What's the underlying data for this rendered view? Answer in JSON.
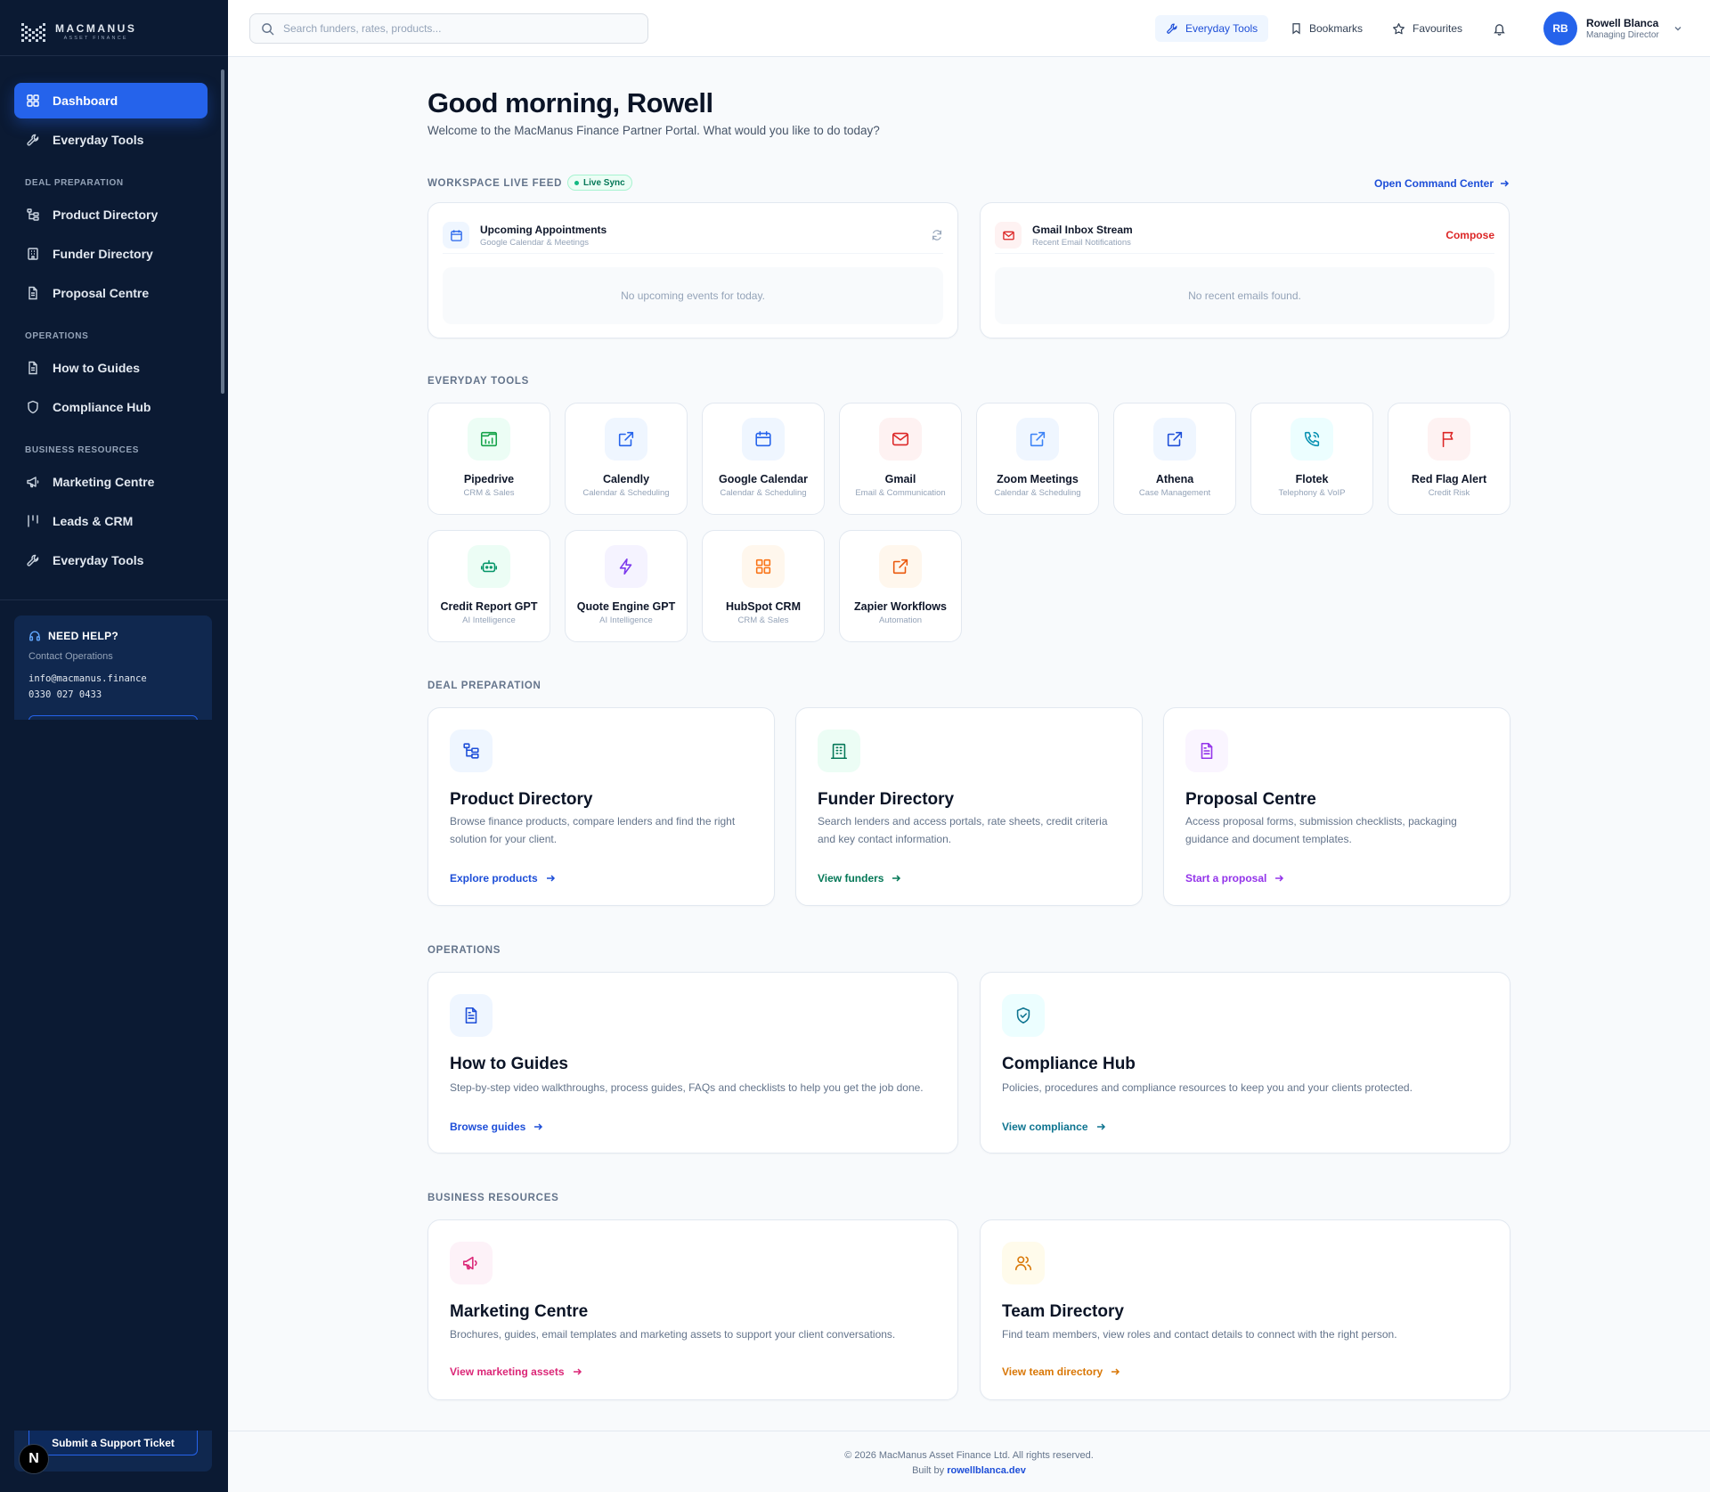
{
  "brand": {
    "name": "MACMANUS",
    "sub": "ASSET FINANCE"
  },
  "sidebar": {
    "items_top": [
      {
        "label": "Dashboard",
        "icon": "grid-icon",
        "active": true
      },
      {
        "label": "Everyday Tools",
        "icon": "wrench-icon"
      }
    ],
    "sections": [
      {
        "title": "DEAL PREPARATION",
        "items": [
          {
            "label": "Product Directory",
            "icon": "tree-icon"
          },
          {
            "label": "Funder Directory",
            "icon": "building-icon"
          },
          {
            "label": "Proposal Centre",
            "icon": "document-icon"
          }
        ]
      },
      {
        "title": "OPERATIONS",
        "items": [
          {
            "label": "How to Guides",
            "icon": "document-icon"
          },
          {
            "label": "Compliance Hub",
            "icon": "shield-icon"
          }
        ]
      },
      {
        "title": "BUSINESS RESOURCES",
        "items": [
          {
            "label": "Marketing Centre",
            "icon": "megaphone-icon"
          },
          {
            "label": "Leads & CRM",
            "icon": "columns-icon"
          },
          {
            "label": "Everyday Tools",
            "icon": "wrench-icon"
          }
        ]
      }
    ],
    "help": {
      "title": "NEED HELP?",
      "subtitle": "Contact Operations",
      "email": "info@macmanus.finance",
      "phone": "0330 027 0433",
      "ticket_button": "Submit a Support Ticket"
    },
    "dev_badge": "N"
  },
  "topbar": {
    "search_placeholder": "Search funders, rates, products...",
    "everyday_tools": "Everyday Tools",
    "bookmarks": "Bookmarks",
    "favourites": "Favourites",
    "user": {
      "initials": "RB",
      "name": "Rowell Blanca",
      "role": "Managing Director"
    }
  },
  "main": {
    "greeting": "Good morning, Rowell",
    "welcome": "Welcome to the MacManus Finance Partner Portal. What would you like to do today?",
    "feed": {
      "label": "WORKSPACE LIVE FEED",
      "badge": "Live Sync",
      "open_link": "Open Command Center",
      "appointments": {
        "title": "Upcoming Appointments",
        "subtitle": "Google Calendar & Meetings",
        "empty": "No upcoming events for today."
      },
      "gmail": {
        "title": "Gmail Inbox Stream",
        "subtitle": "Recent Email Notifications",
        "action": "Compose",
        "empty": "No recent emails found."
      }
    },
    "tools_label": "EVERYDAY TOOLS",
    "tools": [
      {
        "name": "Pipedrive",
        "category": "CRM & Sales",
        "icon": "pipedrive-chart-icon",
        "bg": "#ecfdf5",
        "fg": "#16a34a"
      },
      {
        "name": "Calendly",
        "category": "Calendar & Scheduling",
        "icon": "external-link-icon",
        "bg": "#eff6ff",
        "fg": "#2563eb"
      },
      {
        "name": "Google Calendar",
        "category": "Calendar & Scheduling",
        "icon": "calendar-icon",
        "bg": "#eff6ff",
        "fg": "#2563eb"
      },
      {
        "name": "Gmail",
        "category": "Email & Communication",
        "icon": "mail-icon",
        "bg": "#fef2f2",
        "fg": "#dc2626"
      },
      {
        "name": "Zoom Meetings",
        "category": "Calendar & Scheduling",
        "icon": "external-link-icon",
        "bg": "#eff6ff",
        "fg": "#3b82f6"
      },
      {
        "name": "Athena",
        "category": "Case Management",
        "icon": "external-link-icon",
        "bg": "#eff6ff",
        "fg": "#1d4ed8"
      },
      {
        "name": "Flotek",
        "category": "Telephony & VoIP",
        "icon": "phone-icon",
        "bg": "#ecfeff",
        "fg": "#0891b2"
      },
      {
        "name": "Red Flag Alert",
        "category": "Credit Risk",
        "icon": "flag-icon",
        "bg": "#fef2f2",
        "fg": "#dc2626"
      },
      {
        "name": "Credit Report GPT",
        "category": "AI Intelligence",
        "icon": "robot-icon",
        "bg": "#ecfdf5",
        "fg": "#059669"
      },
      {
        "name": "Quote Engine GPT",
        "category": "AI Intelligence",
        "icon": "lightning-icon",
        "bg": "#f5f3ff",
        "fg": "#7c3aed"
      },
      {
        "name": "HubSpot CRM",
        "category": "CRM & Sales",
        "icon": "grid-icon",
        "bg": "#fff7ed",
        "fg": "#f97316"
      },
      {
        "name": "Zapier Workflows",
        "category": "Automation",
        "icon": "external-link-icon",
        "bg": "#fff7ed",
        "fg": "#ea580c"
      }
    ],
    "deal": {
      "label": "DEAL PREPARATION",
      "cards": [
        {
          "title": "Product Directory",
          "desc": "Browse finance products, compare lenders and find the right solution for your client.",
          "link": "Explore products",
          "icon": "tree-icon",
          "bg": "#eff6ff",
          "fg": "#1d4ed8"
        },
        {
          "title": "Funder Directory",
          "desc": "Search lenders and access portals, rate sheets, credit criteria and key contact information.",
          "link": "View funders",
          "icon": "building-icon",
          "bg": "#ecfdf5",
          "fg": "#047857"
        },
        {
          "title": "Proposal Centre",
          "desc": "Access proposal forms, submission checklists, packaging guidance and document templates.",
          "link": "Start a proposal",
          "icon": "document-icon",
          "bg": "#faf5ff",
          "fg": "#9333ea"
        }
      ]
    },
    "operations": {
      "label": "OPERATIONS",
      "cards": [
        {
          "title": "How to Guides",
          "desc": "Step-by-step video walkthroughs, process guides, FAQs and checklists to help you get the job done.",
          "link": "Browse guides",
          "icon": "document-icon",
          "bg": "#eff6ff",
          "fg": "#1d4ed8"
        },
        {
          "title": "Compliance Hub",
          "desc": "Policies, procedures and compliance resources to keep you and your clients protected.",
          "link": "View compliance",
          "icon": "shield-check-icon",
          "bg": "#ecfeff",
          "fg": "#0e7490"
        }
      ]
    },
    "business": {
      "label": "BUSINESS RESOURCES",
      "cards": [
        {
          "title": "Marketing Centre",
          "desc": "Brochures, guides, email templates and marketing assets to support your client conversations.",
          "link": "View marketing assets",
          "icon": "megaphone-icon",
          "bg": "#fdf2f8",
          "fg": "#db2777"
        },
        {
          "title": "Team Directory",
          "desc": "Find team members, view roles and contact details to connect with the right person.",
          "link": "View team directory",
          "icon": "users-icon",
          "bg": "#fffbeb",
          "fg": "#d97706"
        }
      ]
    }
  },
  "footer": {
    "copyright": "© 2026 MacManus Asset Finance Ltd. All rights reserved.",
    "built_by": "Built by",
    "built_by_link": "rowellblanca.dev"
  }
}
